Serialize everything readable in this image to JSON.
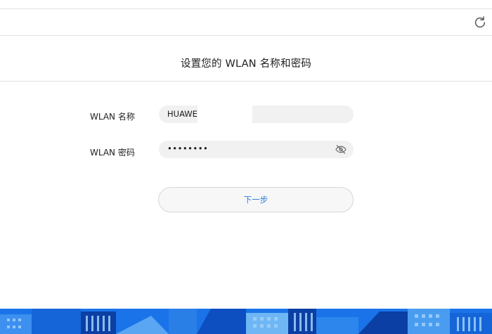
{
  "toolbar": {
    "refresh_icon": "refresh-icon"
  },
  "page": {
    "title": "设置您的 WLAN 名称和密码"
  },
  "form": {
    "ssid_label": "WLAN 名称",
    "ssid_value": "HUAWEI",
    "password_label": "WLAN 密码",
    "password_value": "••••••••",
    "eye_icon": "eye-hidden-icon",
    "next_label": "下一步"
  },
  "colors": {
    "accent": "#2d7ed4",
    "footer_blue": "#1a73e8",
    "footer_light": "#6fb6f4",
    "footer_dark": "#0b3fa3"
  }
}
